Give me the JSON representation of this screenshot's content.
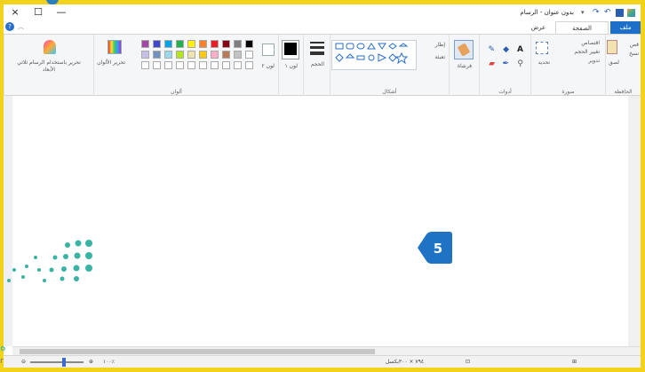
{
  "window": {
    "title": "بدون عنوان - الرسام",
    "controls": [
      "×",
      "☐",
      "—"
    ]
  },
  "tabs": {
    "file": "ملف",
    "home": "الصفحة الرئيسية",
    "view": "عرض",
    "help": "?"
  },
  "ribbon": {
    "clipboard": {
      "label": "الحافظة",
      "paste": "لصق",
      "cut": "قص",
      "copy": "نسخ"
    },
    "image": {
      "label": "صورة",
      "select": "تحديد",
      "crop": "اقتصاص",
      "resize": "تغيير الحجم",
      "rotate": "تدوير"
    },
    "tools": {
      "label": "أدوات"
    },
    "brushes": {
      "label": "فرشاة"
    },
    "shapes": {
      "label": "أشكال",
      "outline": "إطار",
      "fill": "تعبئة"
    },
    "size": {
      "label": "الحجم"
    },
    "color1": {
      "label": "لون ١"
    },
    "color2": {
      "label": "لون ٢"
    },
    "colors": {
      "label": "ألوان",
      "edit_colors": "تحرير الألوان"
    },
    "paint3d": {
      "label": "تحرير باستخدام الرسام ثلاثي الأبعاد"
    }
  },
  "palette": {
    "row1": [
      "#000000",
      "#7f7f7f",
      "#880015",
      "#ed1c24",
      "#ff7f27",
      "#fff200",
      "#22b14c",
      "#00a2e8",
      "#3f48cc",
      "#a349a4"
    ],
    "row2": [
      "#ffffff",
      "#c3c3c3",
      "#b97a57",
      "#ffaec9",
      "#ffc90e",
      "#efe4b0",
      "#b5e61d",
      "#99d9ea",
      "#7092be",
      "#c8bfe7"
    ],
    "row3": [
      "#ffffff",
      "#ffffff",
      "#ffffff",
      "#ffffff",
      "#ffffff",
      "#ffffff",
      "#ffffff",
      "#ffffff",
      "#ffffff",
      "#ffffff"
    ]
  },
  "badge": {
    "number": "5",
    "color": "#1f73c4"
  },
  "status": {
    "dimensions": "٧٩٤ × ٣٠٠بكسل",
    "zoom": "١٠٠٪"
  },
  "colors": {
    "frame": "#f3d21b",
    "accent": "#1e6fc8",
    "logo_teal": "#39b3a4",
    "logo_green": "#2ea36a"
  }
}
